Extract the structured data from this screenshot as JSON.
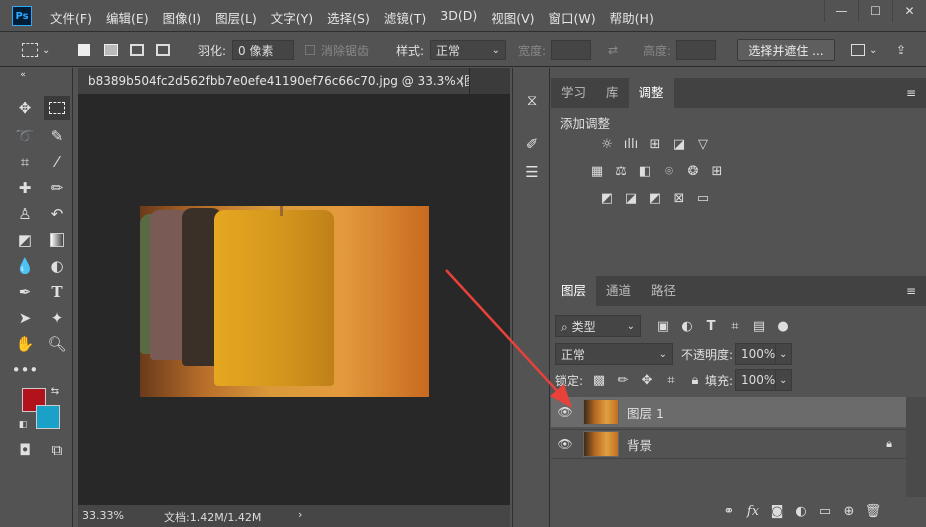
{
  "app": {
    "logo": "Ps"
  },
  "menu": [
    "文件(F)",
    "编辑(E)",
    "图像(I)",
    "图层(L)",
    "文字(Y)",
    "选择(S)",
    "滤镜(T)",
    "3D(D)",
    "视图(V)",
    "窗口(W)",
    "帮助(H)"
  ],
  "window_controls": [
    "—",
    "☐",
    "✕"
  ],
  "options": {
    "feather_label": "羽化:",
    "feather_value": "0 像素",
    "antialias_label": "消除锯齿",
    "style_label": "样式:",
    "style_value": "正常",
    "width_label": "宽度:",
    "height_label": "高度:",
    "select_mask_button": "选择并遮住 ..."
  },
  "document": {
    "tab_title": "b8389b504fc2d562fbb7e0efe41190ef76c66c70.jpg @ 33.3% (图...",
    "close": "×"
  },
  "status": {
    "zoom": "33.33%",
    "doc_info": "文档:1.42M/1.42M",
    "more": "›"
  },
  "top_panel": {
    "tabs": [
      "学习",
      "库",
      "调整"
    ],
    "active_tab": "调整",
    "title": "添加调整"
  },
  "layers_panel": {
    "tabs": [
      "图层",
      "通道",
      "路径"
    ],
    "active_tab": "图层",
    "filter_label": "类型",
    "blend_mode": "正常",
    "opacity_label": "不透明度:",
    "opacity_value": "100%",
    "lock_label": "锁定:",
    "fill_label": "填充:",
    "fill_value": "100%",
    "layers": [
      {
        "name": "图层 1",
        "selected": true,
        "locked": false
      },
      {
        "name": "背景",
        "selected": false,
        "locked": true
      }
    ]
  },
  "colors": {
    "foreground": "#b1121b",
    "background": "#1aa1c7",
    "annotation_arrow": "#e8413a"
  }
}
